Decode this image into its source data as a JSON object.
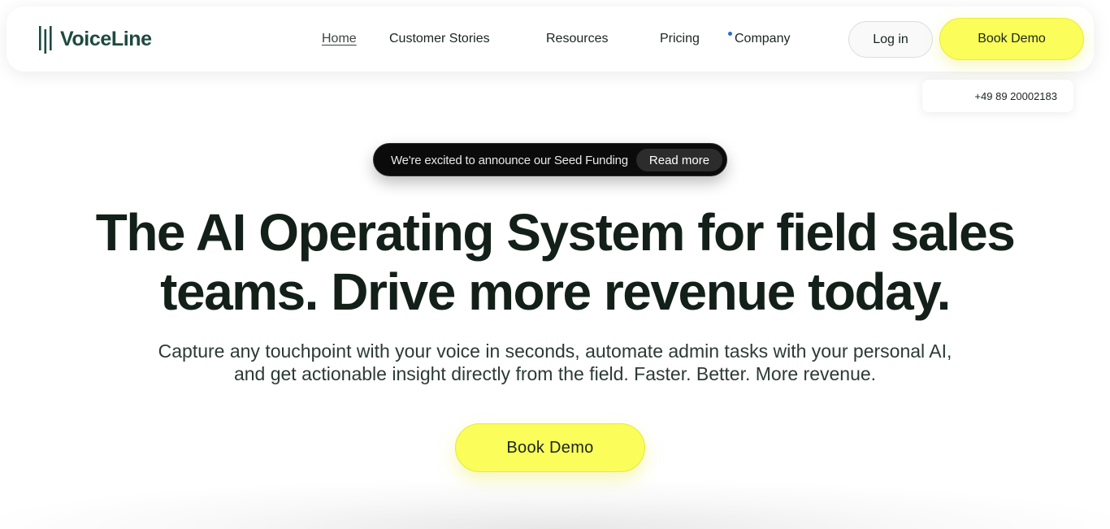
{
  "header": {
    "logo_text": "VoiceLine",
    "nav": [
      {
        "label": "Home",
        "active": true
      },
      {
        "label": "Customer Stories"
      },
      {
        "label": "Resources"
      },
      {
        "label": "Pricing"
      },
      {
        "label": "Company"
      }
    ],
    "login_label": "Log in",
    "book_demo_label": "Book Demo",
    "phone": "+49 89 20002183"
  },
  "announcement": {
    "text": "We're excited to announce our Seed Funding",
    "cta": "Read more"
  },
  "hero": {
    "title_line1": "The AI Operating System for field sales",
    "title_line2": "teams. Drive more revenue today.",
    "subtitle_line1": "Capture any touchpoint with your voice in seconds, automate admin tasks with your personal AI,",
    "subtitle_line2": "and get actionable insight directly from the field. Faster. Better. More revenue.",
    "cta": "Book Demo"
  },
  "colors": {
    "accent_yellow": "#fafd5a",
    "brand_green": "#1e4a40",
    "dark_text": "#132019",
    "dot_blue": "#1f6fd1"
  }
}
